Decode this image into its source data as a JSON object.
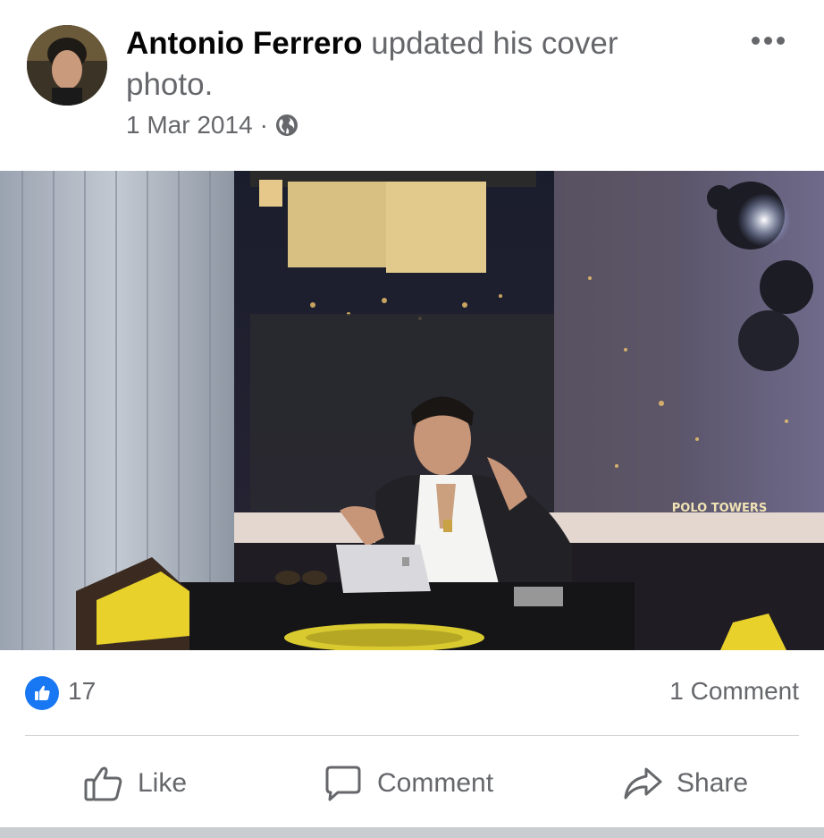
{
  "post": {
    "author_name": "Antonio Ferrero",
    "action_text": "updated his cover photo.",
    "date": "1 Mar 2014",
    "separator": "·",
    "privacy_icon": "globe-icon",
    "more_icon": "more-horizontal-icon"
  },
  "photo": {
    "sign_text": "POLO TOWERS"
  },
  "stats": {
    "like_count": "17",
    "comment_count": "1 Comment",
    "like_icon": "thumbs-up-icon"
  },
  "actions": {
    "like_label": "Like",
    "comment_label": "Comment",
    "share_label": "Share"
  },
  "colors": {
    "accent": "#1877f2",
    "secondary_text": "#65676b",
    "divider": "#ced0d4"
  }
}
